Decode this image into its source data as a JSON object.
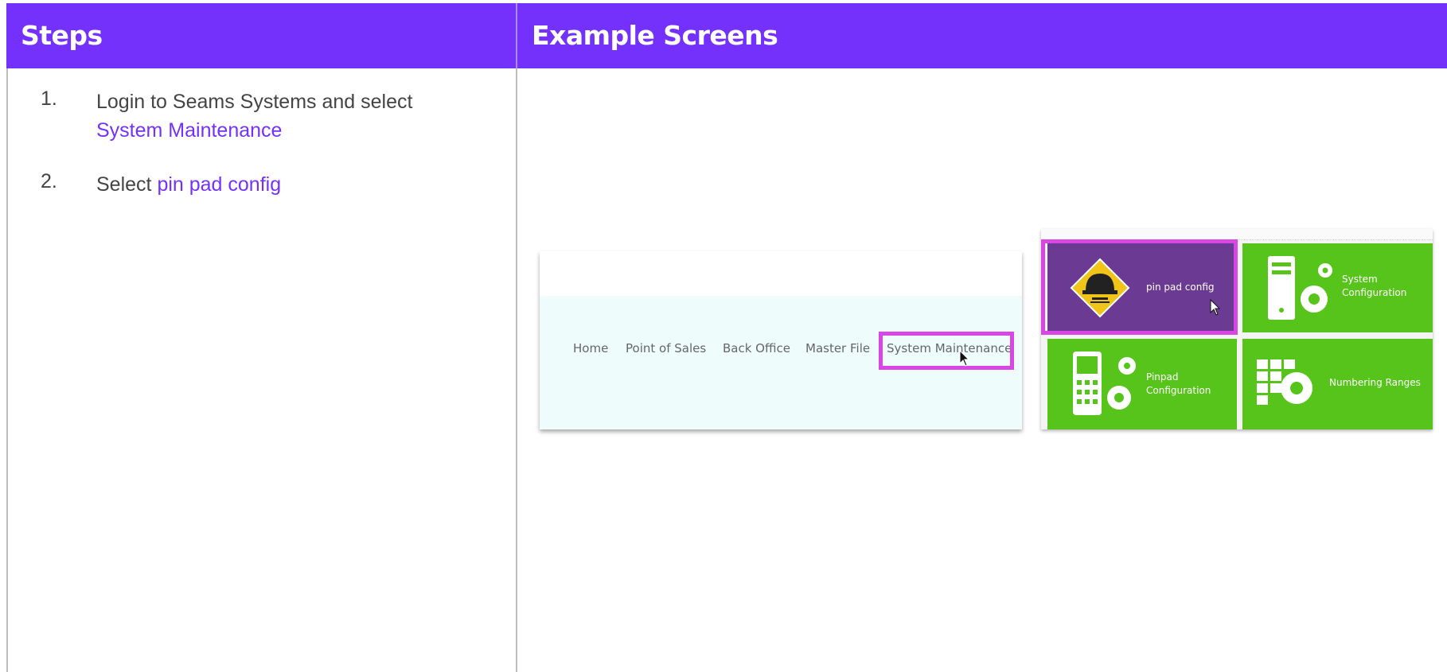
{
  "header": {
    "steps_title": "Steps",
    "examples_title": "Example Screens"
  },
  "steps": [
    {
      "number": "1.",
      "text": "Login to Seams Systems and select ",
      "link": "System Maintenance"
    },
    {
      "number": "2.",
      "text": "Select ",
      "link": "pin pad config"
    }
  ],
  "screen_nav": {
    "items": [
      "Home",
      "Point of Sales",
      "Back Office",
      "Master File",
      "System Maintenance"
    ],
    "highlighted": "System Maintenance"
  },
  "screen_tiles": {
    "tiles": [
      {
        "label": "pin pad config",
        "icon": "hard-hat-warning-icon"
      },
      {
        "label_line1": "System",
        "label_line2": "Configuration",
        "icon": "computer-gear-icon"
      },
      {
        "label_line1": "Pinpad",
        "label_line2": "Configuration",
        "icon": "pinpad-gear-icon"
      },
      {
        "label": "Numbering Ranges",
        "icon": "grid-gear-icon"
      }
    ],
    "highlighted": "pin pad config"
  },
  "colors": {
    "header_bg": "#7431fb",
    "link": "#7431fb",
    "highlight": "#d846e5",
    "tile_green": "#57c41b",
    "tile_purple": "#6b3b93"
  }
}
